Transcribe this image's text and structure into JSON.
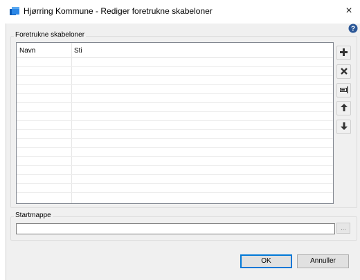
{
  "window": {
    "title": "Hjørring Kommune - Rediger foretrukne skabeloner",
    "close_glyph": "×"
  },
  "templates_group": {
    "label": "Foretrukne skabeloner",
    "columns": [
      "Navn",
      "Sti"
    ],
    "rows": []
  },
  "side_buttons": {
    "add": "add-icon",
    "remove": "remove-icon",
    "rename": "rename-icon",
    "move_up": "arrow-up-icon",
    "move_down": "arrow-down-icon"
  },
  "start_folder": {
    "label": "Startmappe",
    "value": "",
    "browse_label": "..."
  },
  "footer": {
    "ok_label": "OK",
    "cancel_label": "Annuller"
  },
  "colors": {
    "accent": "#0078d7",
    "help_icon": "#2b5797",
    "icon_dark": "#333333"
  }
}
